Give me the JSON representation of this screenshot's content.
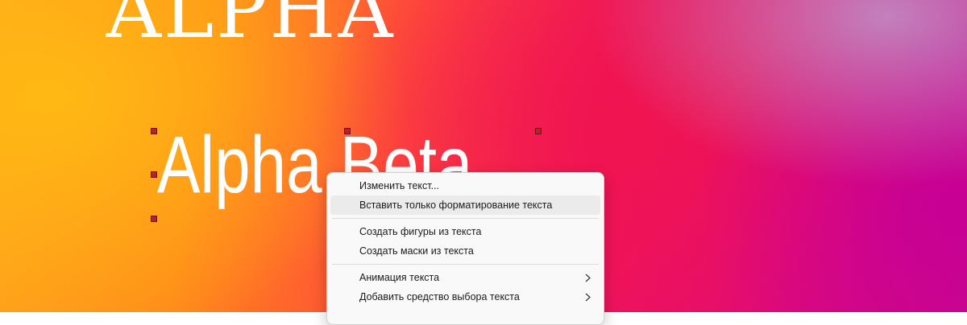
{
  "canvas": {
    "heading_serif": "ALPHA",
    "heading_sans": "Alpha Beta"
  },
  "context_menu": {
    "items": [
      {
        "label": "Изменить текст..."
      },
      {
        "label": "Вставить только форматирование текста",
        "highlighted": true
      },
      {
        "label": "Создать фигуры из текста"
      },
      {
        "label": "Создать маски из текста"
      },
      {
        "label": "Анимация текста",
        "submenu": true,
        "icon": "chevron-right-icon"
      },
      {
        "label": "Добавить средство выбора текста",
        "submenu": true,
        "icon": "chevron-right-icon"
      }
    ]
  },
  "colors": {
    "gradient_left": "#ffa51c",
    "gradient_mid": "#f0145a",
    "gradient_right": "#c8088a",
    "selection_handle": "#b8222c",
    "menu_background": "#f9f9f9",
    "menu_highlight": "#ebebeb"
  }
}
